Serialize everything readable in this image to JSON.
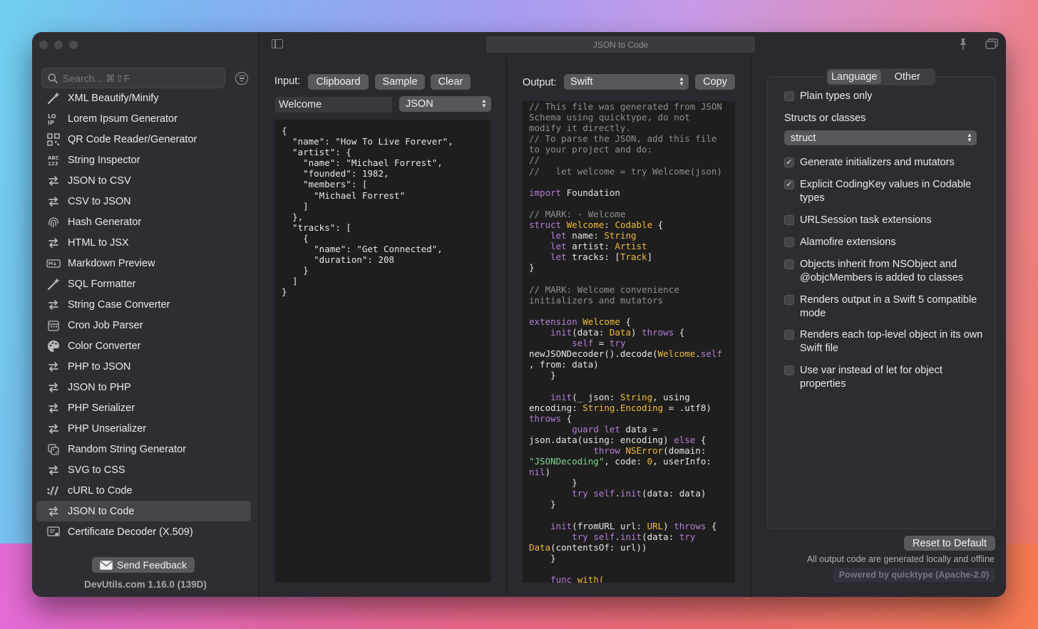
{
  "window": {
    "title": "JSON to Code"
  },
  "sidebar": {
    "search_placeholder": "Search... ⌘⇧F",
    "items": [
      {
        "label": "XML Beautify/Minify",
        "icon": "wand-icon"
      },
      {
        "label": "Lorem Ipsum Generator",
        "icon": "lorem-ipsum-icon"
      },
      {
        "label": "QR Code Reader/Generator",
        "icon": "qr-code-icon"
      },
      {
        "label": "String Inspector",
        "icon": "abc-123-icon"
      },
      {
        "label": "JSON to CSV",
        "icon": "convert-arrows-icon"
      },
      {
        "label": "CSV to JSON",
        "icon": "convert-arrows-icon"
      },
      {
        "label": "Hash Generator",
        "icon": "fingerprint-icon"
      },
      {
        "label": "HTML to JSX",
        "icon": "convert-arrows-icon"
      },
      {
        "label": "Markdown Preview",
        "icon": "markdown-icon"
      },
      {
        "label": "SQL Formatter",
        "icon": "wand-icon"
      },
      {
        "label": "String Case Converter",
        "icon": "convert-arrows-icon"
      },
      {
        "label": "Cron Job Parser",
        "icon": "calendar-icon"
      },
      {
        "label": "Color Converter",
        "icon": "palette-icon"
      },
      {
        "label": "PHP to JSON",
        "icon": "convert-arrows-icon"
      },
      {
        "label": "JSON to PHP",
        "icon": "convert-arrows-icon"
      },
      {
        "label": "PHP Serializer",
        "icon": "convert-arrows-icon"
      },
      {
        "label": "PHP Unserializer",
        "icon": "convert-arrows-icon"
      },
      {
        "label": "Random String Generator",
        "icon": "dice-icon"
      },
      {
        "label": "SVG to CSS",
        "icon": "convert-arrows-icon"
      },
      {
        "label": "cURL to Code",
        "icon": "curl-icon"
      },
      {
        "label": "JSON to Code",
        "icon": "convert-arrows-icon",
        "active": true
      },
      {
        "label": "Certificate Decoder (X.509)",
        "icon": "certificate-icon"
      }
    ],
    "feedback_label": "Send Feedback",
    "version": "DevUtils.com 1.16.0 (139D)"
  },
  "input": {
    "label": "Input:",
    "clipboard_label": "Clipboard",
    "sample_label": "Sample",
    "clear_label": "Clear",
    "name_value": "Welcome",
    "format_value": "JSON",
    "code": "{\n  \"name\": \"How To Live Forever\",\n  \"artist\": {\n    \"name\": \"Michael Forrest\",\n    \"founded\": 1982,\n    \"members\": [\n      \"Michael Forrest\"\n    ]\n  },\n  \"tracks\": [\n    {\n      \"name\": \"Get Connected\",\n      \"duration\": 208\n    }\n  ]\n}"
  },
  "output": {
    "label": "Output:",
    "language_value": "Swift",
    "copy_label": "Copy",
    "code_lines": [
      [
        [
          "c",
          "// This file was generated from JSON"
        ]
      ],
      [
        [
          "c",
          "Schema using quicktype, do not"
        ]
      ],
      [
        [
          "c",
          "modify it directly."
        ]
      ],
      [
        [
          "c",
          "// To parse the JSON, add this file"
        ]
      ],
      [
        [
          "c",
          "to your project and do:"
        ]
      ],
      [
        [
          "c",
          "//"
        ]
      ],
      [
        [
          "c",
          "//   let welcome = try Welcome(json)"
        ]
      ],
      [
        [
          "p",
          ""
        ]
      ],
      [
        [
          "k",
          "import"
        ],
        [
          "p",
          " Foundation"
        ]
      ],
      [
        [
          "p",
          ""
        ]
      ],
      [
        [
          "c",
          "// MARK: - Welcome"
        ]
      ],
      [
        [
          "k",
          "struct"
        ],
        [
          "p",
          " "
        ],
        [
          "t",
          "Welcome"
        ],
        [
          "p",
          ": "
        ],
        [
          "t",
          "Codable"
        ],
        [
          "p",
          " {"
        ]
      ],
      [
        [
          "p",
          "    "
        ],
        [
          "k",
          "let"
        ],
        [
          "p",
          " name: "
        ],
        [
          "t",
          "String"
        ]
      ],
      [
        [
          "p",
          "    "
        ],
        [
          "k",
          "let"
        ],
        [
          "p",
          " artist: "
        ],
        [
          "t",
          "Artist"
        ]
      ],
      [
        [
          "p",
          "    "
        ],
        [
          "k",
          "let"
        ],
        [
          "p",
          " tracks: ["
        ],
        [
          "t",
          "Track"
        ],
        [
          "p",
          "]"
        ]
      ],
      [
        [
          "p",
          "}"
        ]
      ],
      [
        [
          "p",
          ""
        ]
      ],
      [
        [
          "c",
          "// MARK: Welcome convenience"
        ]
      ],
      [
        [
          "c",
          "initializers and mutators"
        ]
      ],
      [
        [
          "p",
          ""
        ]
      ],
      [
        [
          "k",
          "extension"
        ],
        [
          "p",
          " "
        ],
        [
          "t",
          "Welcome"
        ],
        [
          "p",
          " {"
        ]
      ],
      [
        [
          "p",
          "    "
        ],
        [
          "k",
          "init"
        ],
        [
          "p",
          "(data: "
        ],
        [
          "t",
          "Data"
        ],
        [
          "p",
          ") "
        ],
        [
          "k",
          "throws"
        ],
        [
          "p",
          " {"
        ]
      ],
      [
        [
          "p",
          "        "
        ],
        [
          "k",
          "self"
        ],
        [
          "p",
          " = "
        ],
        [
          "k",
          "try"
        ]
      ],
      [
        [
          "p",
          "newJSONDecoder().decode("
        ],
        [
          "t",
          "Welcome"
        ],
        [
          "p",
          "."
        ],
        [
          "k",
          "self"
        ]
      ],
      [
        [
          "p",
          ", from: data)"
        ]
      ],
      [
        [
          "p",
          "    }"
        ]
      ],
      [
        [
          "p",
          ""
        ]
      ],
      [
        [
          "p",
          "    "
        ],
        [
          "k",
          "init"
        ],
        [
          "p",
          "(_ json: "
        ],
        [
          "t",
          "String"
        ],
        [
          "p",
          ", using"
        ]
      ],
      [
        [
          "p",
          "encoding: "
        ],
        [
          "t",
          "String.Encoding"
        ],
        [
          "p",
          " = .utf8)"
        ]
      ],
      [
        [
          "k",
          "throws"
        ],
        [
          "p",
          " {"
        ]
      ],
      [
        [
          "p",
          "        "
        ],
        [
          "k",
          "guard let"
        ],
        [
          "p",
          " data ="
        ]
      ],
      [
        [
          "p",
          "json.data(using: encoding) "
        ],
        [
          "k",
          "else"
        ],
        [
          "p",
          " {"
        ]
      ],
      [
        [
          "p",
          "            "
        ],
        [
          "k",
          "throw"
        ],
        [
          "p",
          " "
        ],
        [
          "t",
          "NSError"
        ],
        [
          "p",
          "(domain:"
        ]
      ],
      [
        [
          "s",
          "\"JSONDecoding\""
        ],
        [
          "p",
          ", code: "
        ],
        [
          "n",
          "0"
        ],
        [
          "p",
          ", userInfo:"
        ]
      ],
      [
        [
          "k",
          "nil"
        ],
        [
          "p",
          ")"
        ]
      ],
      [
        [
          "p",
          "        }"
        ]
      ],
      [
        [
          "p",
          "        "
        ],
        [
          "k",
          "try self"
        ],
        [
          "p",
          "."
        ],
        [
          "k",
          "init"
        ],
        [
          "p",
          "(data: data)"
        ]
      ],
      [
        [
          "p",
          "    }"
        ]
      ],
      [
        [
          "p",
          ""
        ]
      ],
      [
        [
          "p",
          "    "
        ],
        [
          "k",
          "init"
        ],
        [
          "p",
          "(fromURL url: "
        ],
        [
          "t",
          "URL"
        ],
        [
          "p",
          ") "
        ],
        [
          "k",
          "throws"
        ],
        [
          "p",
          " {"
        ]
      ],
      [
        [
          "p",
          "        "
        ],
        [
          "k",
          "try self"
        ],
        [
          "p",
          "."
        ],
        [
          "k",
          "init"
        ],
        [
          "p",
          "(data: "
        ],
        [
          "k",
          "try"
        ]
      ],
      [
        [
          "t",
          "Data"
        ],
        [
          "p",
          "(contentsOf: url))"
        ]
      ],
      [
        [
          "p",
          "    }"
        ]
      ],
      [
        [
          "p",
          ""
        ]
      ],
      [
        [
          "p",
          "    "
        ],
        [
          "k",
          "func"
        ],
        [
          "p",
          " "
        ],
        [
          "t",
          "with("
        ]
      ]
    ]
  },
  "options": {
    "tabs": [
      {
        "label": "Language",
        "selected": true
      },
      {
        "label": "Other",
        "selected": false
      }
    ],
    "plain_types": {
      "label": "Plain types only",
      "checked": false
    },
    "structs_label": "Structs or classes",
    "structs_value": "struct",
    "checkboxes": [
      {
        "label": "Generate initializers and mutators",
        "checked": true
      },
      {
        "label": "Explicit CodingKey values in Codable types",
        "checked": true
      },
      {
        "label": "URLSession task extensions",
        "checked": false
      },
      {
        "label": "Alamofire extensions",
        "checked": false
      },
      {
        "label": "Objects inherit from NSObject and @objcMembers is added to classes",
        "checked": false
      },
      {
        "label": "Renders output in a Swift 5 compatible mode",
        "checked": false
      },
      {
        "label": "Renders each top-level object in its own Swift file",
        "checked": false
      },
      {
        "label": "Use var instead of let for object properties",
        "checked": false
      }
    ],
    "reset_label": "Reset to Default",
    "footnote": "All output code are generated locally and offline",
    "powered_by": "Powered by quicktype (Apache-2.0)"
  }
}
